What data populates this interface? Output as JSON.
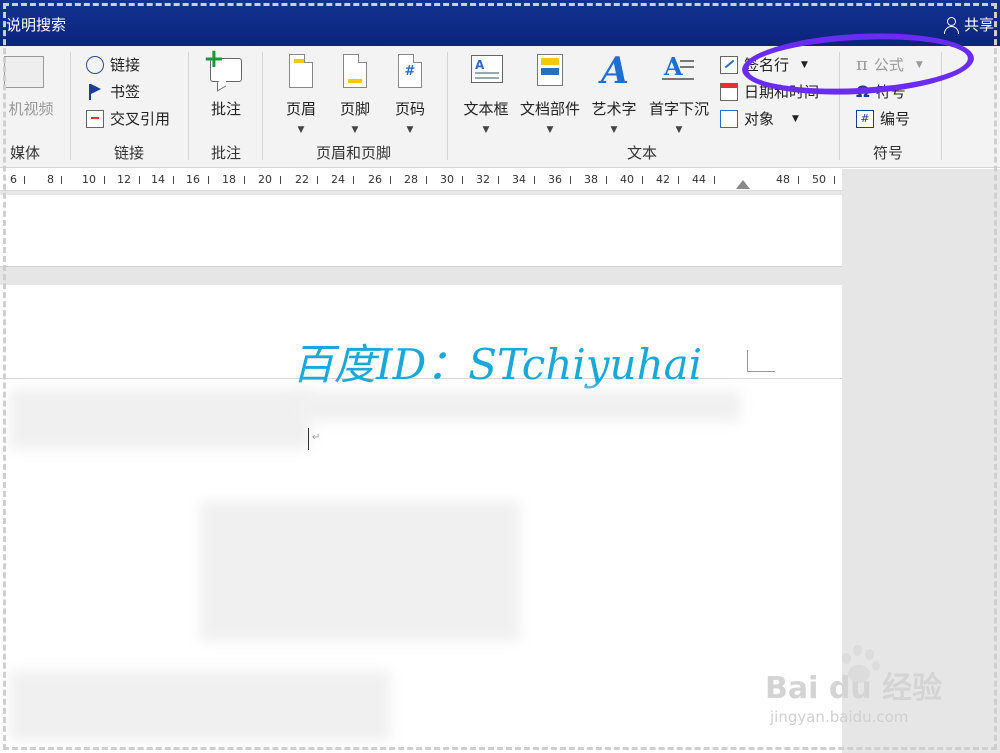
{
  "titlebar": {
    "search_label": "说明搜索",
    "share_label": "共享"
  },
  "ribbon": {
    "groups": {
      "media": "媒体",
      "links": "链接",
      "comments": "批注",
      "header_footer": "页眉和页脚",
      "text": "文本",
      "symbols": "符号"
    },
    "media": {
      "online_video": "机视频"
    },
    "links": {
      "link": "链接",
      "bookmark": "书签",
      "cross_ref": "交叉引用"
    },
    "comments": {
      "comment": "批注"
    },
    "header_footer": {
      "header": "页眉",
      "footer": "页脚",
      "page_number": "页码"
    },
    "text": {
      "textbox": "文本框",
      "quick_parts": "文档部件",
      "wordart": "艺术字",
      "drop_cap": "首字下沉",
      "signature_line": "签名行",
      "date_time": "日期和时间",
      "object": "对象"
    },
    "symbols": {
      "equation": "公式",
      "symbol": "符号",
      "number": "编号"
    }
  },
  "ruler": {
    "ticks": [
      "6",
      "8",
      "10",
      "12",
      "14",
      "16",
      "18",
      "20",
      "22",
      "24",
      "26",
      "28",
      "30",
      "32",
      "34",
      "36",
      "38",
      "40",
      "42",
      "44",
      "48",
      "50"
    ]
  },
  "document": {
    "watermark_text": "百度ID：STchiyuhai"
  },
  "watermark": {
    "brand": "Bai du 经验",
    "url": "jingyan.baidu.com"
  },
  "colors": {
    "titlebar": "#0b247c",
    "highlight_oval": "#6a2cf2",
    "watermark": "#19a8d8"
  }
}
